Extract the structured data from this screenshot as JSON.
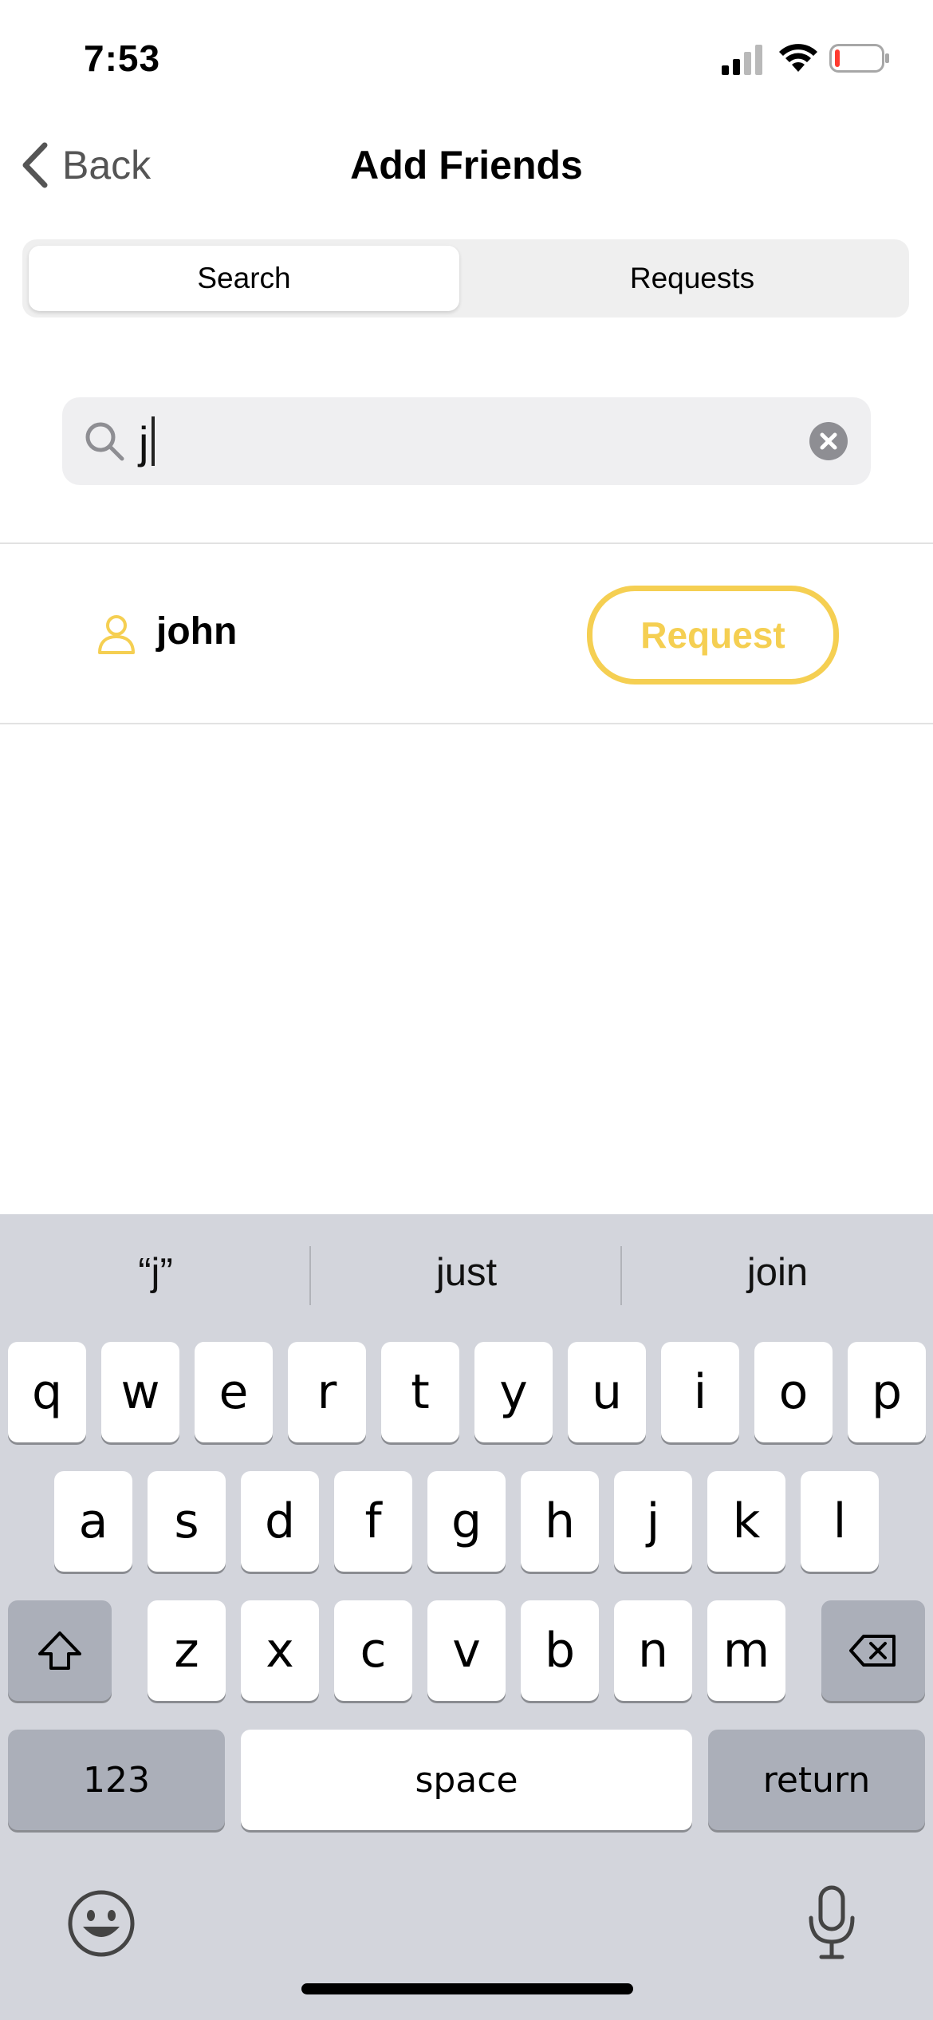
{
  "status_bar": {
    "time": "7:53",
    "signal_icon": "cellular-signal-icon",
    "wifi_icon": "wifi-icon",
    "battery_icon": "battery-low-icon",
    "battery_level": 0.1,
    "battery_color": "#ff3b30"
  },
  "nav": {
    "back_label": "Back",
    "back_icon": "chevron-left-icon",
    "title": "Add Friends"
  },
  "segments": [
    {
      "label": "Search",
      "selected": true
    },
    {
      "label": "Requests",
      "selected": false
    }
  ],
  "search": {
    "value": "j",
    "search_icon": "magnifying-glass-icon",
    "clear_icon": "clear-circle-icon"
  },
  "results": [
    {
      "name": "john",
      "icon": "person-icon",
      "action_label": "Request"
    }
  ],
  "colors": {
    "accent": "#f5cf52",
    "keyboard_background": "#d3d5dc",
    "segmented_background": "#efefef",
    "search_field_background": "#efeff1"
  },
  "keyboard": {
    "suggestions": [
      "“j”",
      "just",
      "join"
    ],
    "row1": [
      "q",
      "w",
      "e",
      "r",
      "t",
      "y",
      "u",
      "i",
      "o",
      "p"
    ],
    "row2": [
      "a",
      "s",
      "d",
      "f",
      "g",
      "h",
      "j",
      "k",
      "l"
    ],
    "row3": [
      "z",
      "x",
      "c",
      "v",
      "b",
      "n",
      "m"
    ],
    "numbers_label": "123",
    "space_label": "space",
    "return_label": "return",
    "shift_icon": "shift-icon",
    "delete_icon": "delete-icon",
    "emoji_icon": "emoji-icon",
    "mic_icon": "microphone-icon"
  }
}
